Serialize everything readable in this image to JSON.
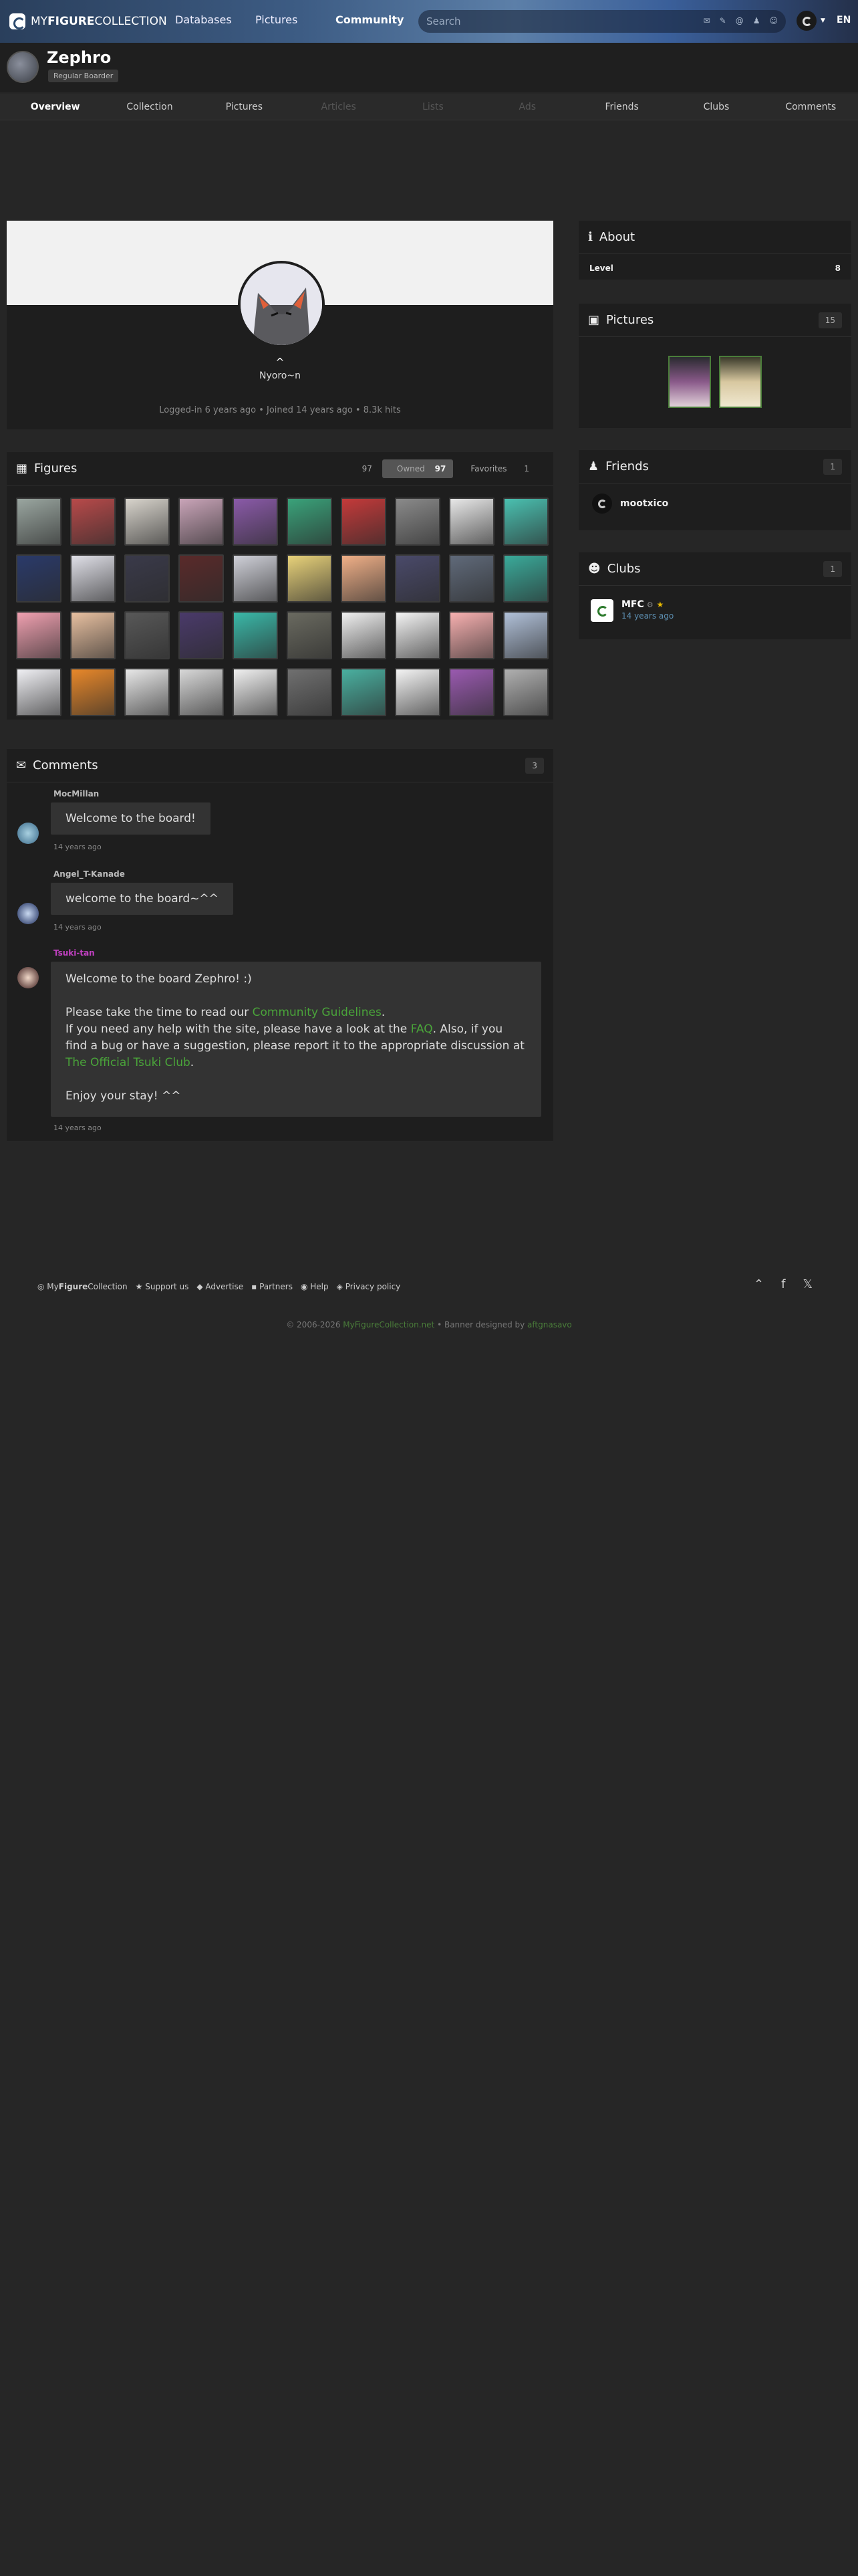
{
  "topbar": {
    "logo_prefix": "MY",
    "logo_bold": "FIGURE",
    "logo_suffix": "COLLECTION",
    "nav": [
      "Databases",
      "Pictures",
      "Community"
    ],
    "search_placeholder": "Search",
    "search_icons": [
      "mail-icon",
      "pencil-icon",
      "at-icon",
      "user-icon",
      "users-icon"
    ],
    "lang": "EN"
  },
  "profile": {
    "name": "Zephro",
    "rank": "Regular Boarder",
    "caret": "^",
    "tagline": "Nyoro~n",
    "meta": "Logged-in 6 years ago • Joined 14 years ago • 8.3k hits"
  },
  "tabs": [
    {
      "label": "Overview",
      "state": "active"
    },
    {
      "label": "Collection",
      "state": "normal"
    },
    {
      "label": "Pictures",
      "state": "normal"
    },
    {
      "label": "Articles",
      "state": "disabled"
    },
    {
      "label": "Lists",
      "state": "disabled"
    },
    {
      "label": "Ads",
      "state": "disabled"
    },
    {
      "label": "Friends",
      "state": "normal"
    },
    {
      "label": "Clubs",
      "state": "normal"
    },
    {
      "label": "Comments",
      "state": "normal"
    }
  ],
  "about": {
    "title": "About",
    "level_label": "Level",
    "level_value": "8"
  },
  "pictures": {
    "title": "Pictures",
    "count": "15"
  },
  "friends": {
    "title": "Friends",
    "count": "1",
    "items": [
      "mootxico"
    ]
  },
  "clubs": {
    "title": "Clubs",
    "count": "1",
    "items": [
      {
        "name": "MFC",
        "date": "14 years ago"
      }
    ]
  },
  "figures": {
    "title": "Figures",
    "filters": {
      "all": "97",
      "owned_label": "Owned",
      "owned_count": "97",
      "favorites_label": "Favorites",
      "favorites_count": "1"
    },
    "thumb_colors": [
      "#9aa6a0",
      "#b84a4a",
      "#d8d4cc",
      "#c9a4b8",
      "#8a5aa8",
      "#3aa27a",
      "#c43a3a",
      "#8a8a8a",
      "#e8e8e8",
      "#4ac0b0",
      "#2a3a6a",
      "#e0e0e8",
      "#3a3a4a",
      "#5a2a2a",
      "#cfd0d8",
      "#e8d27a",
      "#f0b088",
      "#4a4a6a",
      "#606a7a",
      "#3aaa9a",
      "#f0a0b0",
      "#e8c0a0",
      "#585858",
      "#4a3a6a",
      "#3ab8a8",
      "#6a6a60",
      "#f0f0f0",
      "#f4f4f4",
      "#f8b0b0",
      "#b0c0d8",
      "#f0f0f4",
      "#e8882a",
      "#e8e8e8",
      "#d8d8d8",
      "#f0f0f0",
      "#707070",
      "#4ab0a0",
      "#f4f4f4",
      "#9a5ab0",
      "#b0b0b0"
    ]
  },
  "comments": {
    "title": "Comments",
    "count": "3",
    "items": [
      {
        "user": "MocMillan",
        "text": "Welcome to the board!",
        "time": "14 years ago"
      },
      {
        "user": "Angel_T-Kanade",
        "text": "welcome to the board~^^",
        "time": "14 years ago"
      },
      {
        "user": "Tsuki-tan",
        "line1": "Welcome to the board Zephro! :)",
        "line2_pre": "Please take the time to read our ",
        "line2_link": "Community Guidelines",
        "line2_post": ".",
        "line3_pre": "If you need any help with the site, please have a look at the ",
        "line3_link": "FAQ",
        "line3_post": ". Also, if you find a bug or have a suggestion, please report it to the appropriate discussion at ",
        "line3_link2": "The Official Tsuki Club",
        "line3_end": ".",
        "line4": "Enjoy your stay! ^^",
        "time": "14 years ago"
      }
    ]
  },
  "footer": {
    "logo_prefix": "My",
    "logo_bold": "Figure",
    "logo_suffix": "Collection",
    "links": [
      "Support us",
      "Advertise",
      "Partners",
      "Help",
      "Privacy policy"
    ],
    "copy_pre": "© 2006-2026 ",
    "copy_site": "MyFigureCollection.net",
    "copy_mid": " • Banner designed by ",
    "copy_designer": "aftgnasavo"
  },
  "colors": {
    "accent_green": "#4aa43a",
    "user_highlight": "#c040c0"
  }
}
